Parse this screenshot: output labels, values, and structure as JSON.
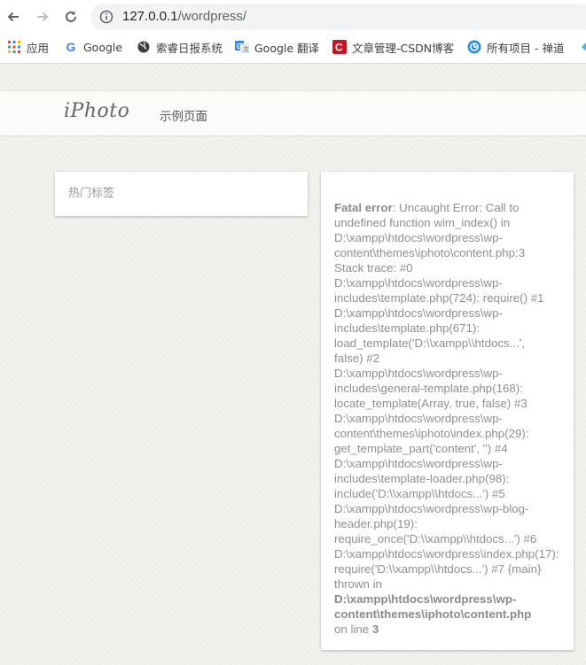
{
  "browser": {
    "url_host": "127.0.0.1",
    "url_path": "/wordpress/",
    "bookmarks": [
      {
        "label": "应用",
        "icon": "apps-grid-icon"
      },
      {
        "label": "Google",
        "icon": "google-icon"
      },
      {
        "label": "索睿日报系统",
        "icon": "globe-icon"
      },
      {
        "label": "Google 翻译",
        "icon": "google-translate-icon"
      },
      {
        "label": "文章管理-CSDN博客",
        "icon": "csdn-icon"
      },
      {
        "label": "所有项目 - 禅道",
        "icon": "zentao-icon"
      }
    ]
  },
  "site": {
    "logo": "iPhoto",
    "menu": [
      "示例页面"
    ],
    "sidebar_widget_title": "热门标签"
  },
  "error": {
    "label": "Fatal error",
    "lines": [
      ": Uncaught Error: Call to",
      "undefined function wim_index() in",
      "D:\\xampp\\htdocs\\wordpress\\wp-",
      "content\\themes\\iphoto\\content.php:3",
      "Stack trace: #0",
      "D:\\xampp\\htdocs\\wordpress\\wp-",
      "includes\\template.php(724): require() #1",
      "D:\\xampp\\htdocs\\wordpress\\wp-",
      "includes\\template.php(671):",
      "load_template('D:\\\\xampp\\\\htdocs...',",
      "false) #2",
      "D:\\xampp\\htdocs\\wordpress\\wp-",
      "includes\\general-template.php(168):",
      "locate_template(Array, true, false) #3",
      "D:\\xampp\\htdocs\\wordpress\\wp-",
      "content\\themes\\iphoto\\index.php(29):",
      "get_template_part('content', '') #4",
      "D:\\xampp\\htdocs\\wordpress\\wp-",
      "includes\\template-loader.php(98):",
      "include('D:\\\\xampp\\\\htdocs...') #5",
      "D:\\xampp\\htdocs\\wordpress\\wp-blog-",
      "header.php(19):",
      "require_once('D:\\\\xampp\\\\htdocs...') #6",
      "D:\\xampp\\htdocs\\wordpress\\index.php(17):",
      "require('D:\\\\xampp\\\\htdocs...') #7 {main}",
      "thrown in"
    ],
    "file_line1": "D:\\xampp\\htdocs\\wordpress\\wp-",
    "file_line2": "content\\themes\\iphoto\\content.php",
    "on_line": "on line",
    "line_number": "3"
  }
}
